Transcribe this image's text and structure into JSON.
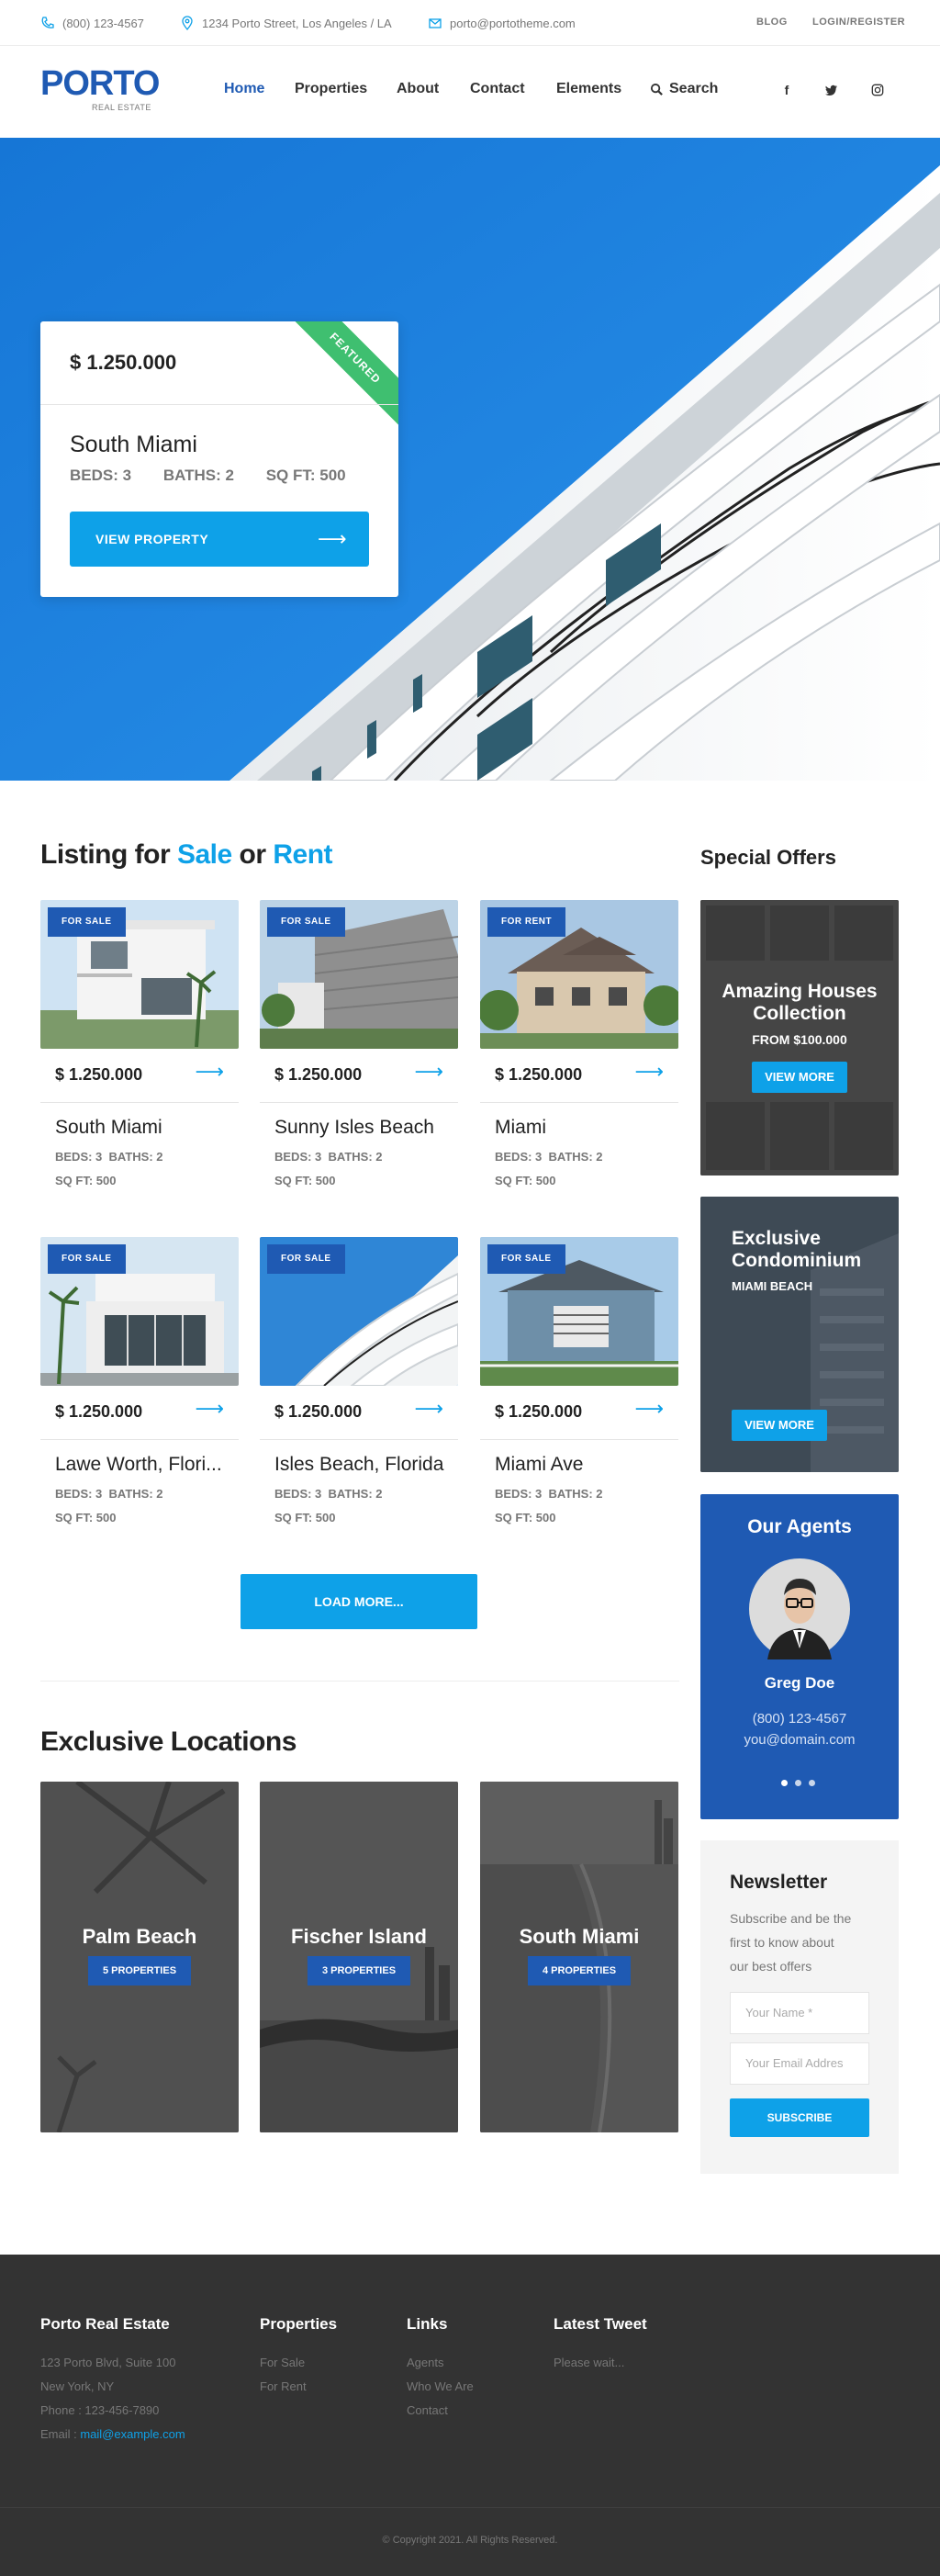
{
  "topbar": {
    "phone": "(800) 123-4567",
    "address": "1234 Porto Street, Los Angeles / LA",
    "email": "porto@portotheme.com",
    "blog": "BLOG",
    "login": "LOGIN/REGISTER"
  },
  "header": {
    "logo": "PORTO",
    "logo_sub": "REAL ESTATE",
    "nav": [
      "Home",
      "Properties",
      "About",
      "Contact",
      "Elements",
      "Search"
    ],
    "social": [
      "f",
      "t",
      "i"
    ]
  },
  "hero": {
    "price": "$ 1.250.000",
    "ribbon": "FEATURED",
    "title": "South Miami",
    "beds": "BEDS: 3",
    "baths": "BATHS: 2",
    "sqft": "SQ FT: 500",
    "button": "VIEW PROPERTY"
  },
  "listing": {
    "title_a": "Listing for ",
    "title_b": "Sale",
    "title_c": " or ",
    "title_d": "Rent",
    "items": [
      {
        "tag": "FOR SALE",
        "price": "$ 1.250.000",
        "name": "South Miami",
        "beds": "BEDS: 3",
        "baths": "BATHS: 2",
        "sqft": "SQ FT: 500"
      },
      {
        "tag": "FOR SALE",
        "price": "$ 1.250.000",
        "name": "Sunny Isles Beach",
        "beds": "BEDS: 3",
        "baths": "BATHS: 2",
        "sqft": "SQ FT: 500"
      },
      {
        "tag": "FOR RENT",
        "price": "$ 1.250.000",
        "name": "Miami",
        "beds": "BEDS: 3",
        "baths": "BATHS: 2",
        "sqft": "SQ FT: 500"
      },
      {
        "tag": "FOR SALE",
        "price": "$ 1.250.000",
        "name": "Lawe Worth, Flori...",
        "beds": "BEDS: 3",
        "baths": "BATHS: 2",
        "sqft": "SQ FT: 500"
      },
      {
        "tag": "FOR SALE",
        "price": "$ 1.250.000",
        "name": "Isles Beach, Florida",
        "beds": "BEDS: 3",
        "baths": "BATHS: 2",
        "sqft": "SQ FT: 500"
      },
      {
        "tag": "FOR SALE",
        "price": "$ 1.250.000",
        "name": "Miami Ave",
        "beds": "BEDS: 3",
        "baths": "BATHS: 2",
        "sqft": "SQ FT: 500"
      }
    ],
    "load_more": "LOAD MORE..."
  },
  "locations": {
    "title": "Exclusive Locations",
    "items": [
      {
        "name": "Palm Beach",
        "count": "5 PROPERTIES"
      },
      {
        "name": "Fischer Island",
        "count": "3 PROPERTIES"
      },
      {
        "name": "South Miami",
        "count": "4 PROPERTIES"
      }
    ]
  },
  "sidebar": {
    "title": "Special Offers",
    "offer1": {
      "title1": "Amazing Houses",
      "title2": "Collection",
      "sub": "FROM $100.000",
      "button": "VIEW MORE"
    },
    "offer2": {
      "title1": "Exclusive",
      "title2": "Condominium",
      "sub": "MIAMI BEACH",
      "button": "VIEW MORE"
    },
    "agents": {
      "title": "Our Agents",
      "name": "Greg Doe",
      "phone": "(800) 123-4567",
      "email": "you@domain.com"
    },
    "newsletter": {
      "title": "Newsletter",
      "text1": "Subscribe and be the",
      "text2": "first to know about",
      "text3": "our best offers",
      "name_ph": "Your Name *",
      "email_ph": "Your Email Addres",
      "button": "SUBSCRIBE"
    }
  },
  "footer": {
    "col1": {
      "title": "Porto Real Estate",
      "l1": "123 Porto Blvd, Suite 100",
      "l2": "New York, NY",
      "l3": "Phone : 123-456-7890",
      "l4a": "Email : ",
      "l4b": "mail@example.com"
    },
    "col2": {
      "title": "Properties",
      "links": [
        "For Sale",
        "For Rent"
      ]
    },
    "col3": {
      "title": "Links",
      "links": [
        "Agents",
        "Who We Are",
        "Contact"
      ]
    },
    "col4": {
      "title": "Latest Tweet",
      "text": "Please wait..."
    },
    "copyright": "© Copyright 2021. All Rights Reserved."
  },
  "colors": {
    "brand": "#1f5ab3",
    "accent": "#0ea1e8",
    "featured": "#3fbf70",
    "footer": "#333333"
  }
}
